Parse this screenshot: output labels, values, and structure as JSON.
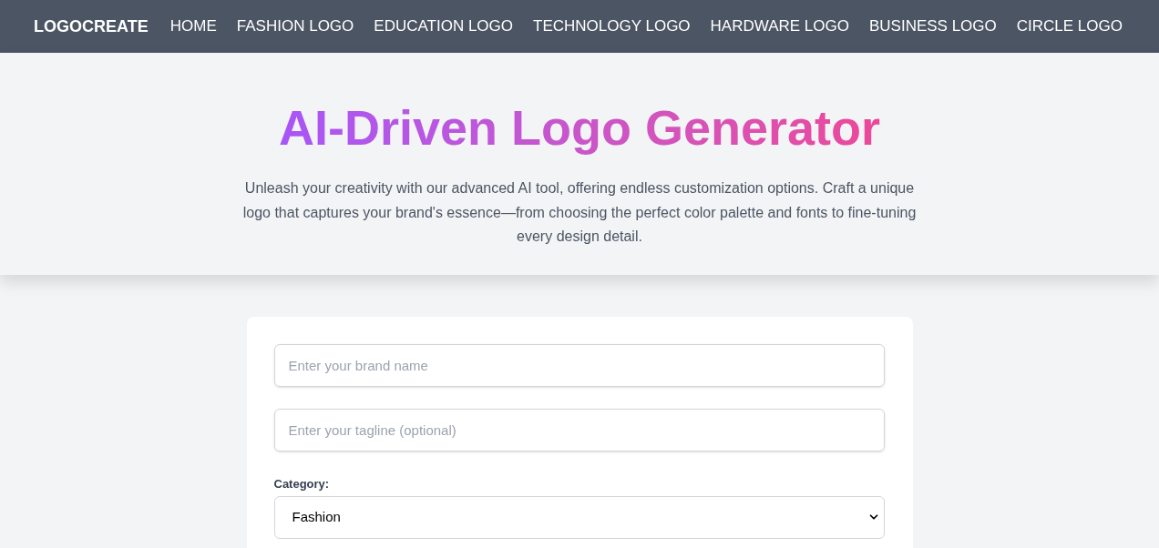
{
  "nav": {
    "brand": "LOGOCREATE",
    "links": [
      "HOME",
      "FASHION LOGO",
      "EDUCATION LOGO",
      "TECHNOLOGY LOGO",
      "HARDWARE LOGO",
      "BUSINESS LOGO",
      "CIRCLE LOGO"
    ]
  },
  "hero": {
    "title": "AI-Driven Logo Generator",
    "description": "Unleash your creativity with our advanced AI tool, offering endless customization options. Craft a unique logo that captures your brand's essence—from choosing the perfect color palette and fonts to fine-tuning every design detail."
  },
  "form": {
    "fields": [
      {
        "placeholder": "Enter your brand name"
      },
      {
        "placeholder": "Enter your tagline (optional)"
      }
    ],
    "category": {
      "label": "Category:",
      "value": "Fashion"
    }
  }
}
